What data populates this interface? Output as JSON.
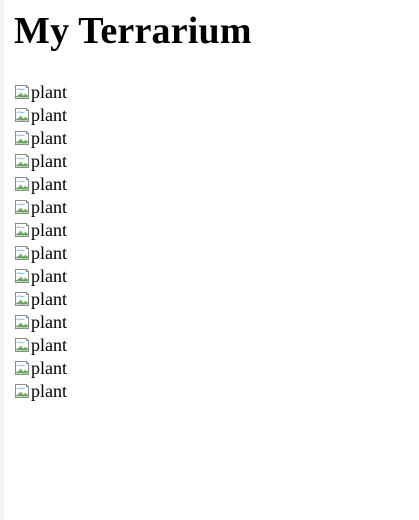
{
  "page": {
    "title": "My Terrarium"
  },
  "plants": [
    {
      "alt": "plant",
      "icon": "broken-image-icon"
    },
    {
      "alt": "plant",
      "icon": "broken-image-icon"
    },
    {
      "alt": "plant",
      "icon": "broken-image-icon"
    },
    {
      "alt": "plant",
      "icon": "broken-image-icon"
    },
    {
      "alt": "plant",
      "icon": "broken-image-icon"
    },
    {
      "alt": "plant",
      "icon": "broken-image-icon"
    },
    {
      "alt": "plant",
      "icon": "broken-image-icon"
    },
    {
      "alt": "plant",
      "icon": "broken-image-icon"
    },
    {
      "alt": "plant",
      "icon": "broken-image-icon"
    },
    {
      "alt": "plant",
      "icon": "broken-image-icon"
    },
    {
      "alt": "plant",
      "icon": "broken-image-icon"
    },
    {
      "alt": "plant",
      "icon": "broken-image-icon"
    },
    {
      "alt": "plant",
      "icon": "broken-image-icon"
    },
    {
      "alt": "plant",
      "icon": "broken-image-icon"
    }
  ]
}
